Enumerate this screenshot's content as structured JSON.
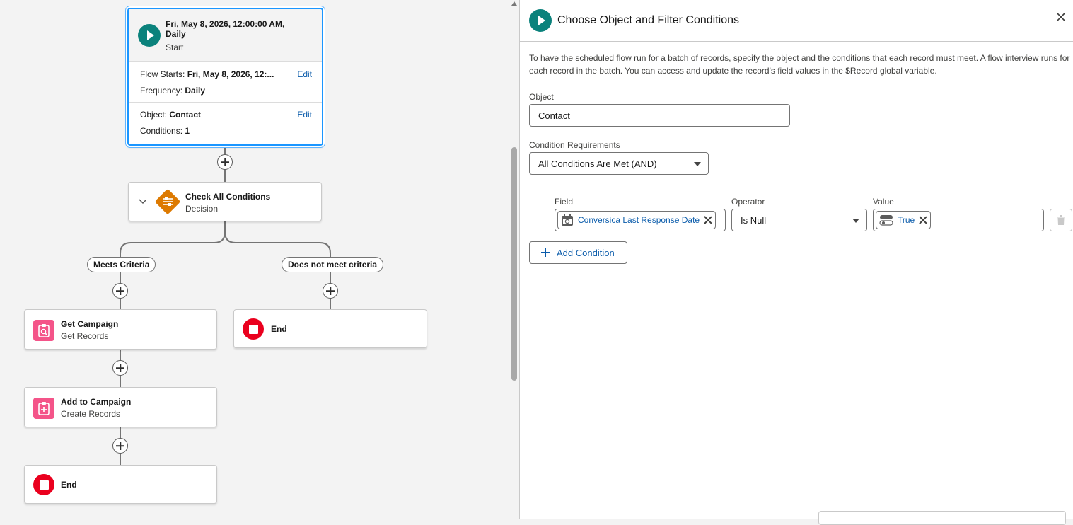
{
  "canvas": {
    "start": {
      "title": "Fri, May 8, 2026, 12:00:00 AM, Daily",
      "subtitle": "Start",
      "flow_starts_label": "Flow Starts:",
      "flow_starts_value": "Fri, May 8, 2026, 12:...",
      "frequency_label": "Frequency:",
      "frequency_value": "Daily",
      "object_label": "Object:",
      "object_value": "Contact",
      "conditions_label": "Conditions:",
      "conditions_value": "1",
      "edit_label": "Edit"
    },
    "decision": {
      "title": "Check All Conditions",
      "subtitle": "Decision"
    },
    "branches": {
      "left": "Meets Criteria",
      "right": "Does not meet criteria"
    },
    "get_campaign": {
      "title": "Get Campaign",
      "subtitle": "Get Records"
    },
    "add_campaign": {
      "title": "Add to Campaign",
      "subtitle": "Create Records"
    },
    "end_label": "End"
  },
  "panel": {
    "title": "Choose Object and Filter Conditions",
    "description": "To have the scheduled flow run for a batch of records, specify the object and the conditions that each record must meet. A flow interview runs for each record in the batch. You can access and update the record's field values in the $Record global variable.",
    "object_label": "Object",
    "object_value": "Contact",
    "cond_req_label": "Condition Requirements",
    "cond_req_value": "All Conditions Are Met (AND)",
    "row": {
      "field_label": "Field",
      "field_value": "Conversica Last Response Date",
      "operator_label": "Operator",
      "operator_value": "Is Null",
      "value_label": "Value",
      "value_value": "True"
    },
    "add_condition_label": "Add Condition"
  },
  "colors": {
    "start_icon": "#0b827c",
    "decision_icon": "#dd7a01",
    "record_icon": "#f45489",
    "end_icon": "#ea001e",
    "link": "#0b5cab",
    "selected_border": "#1b96ff"
  }
}
